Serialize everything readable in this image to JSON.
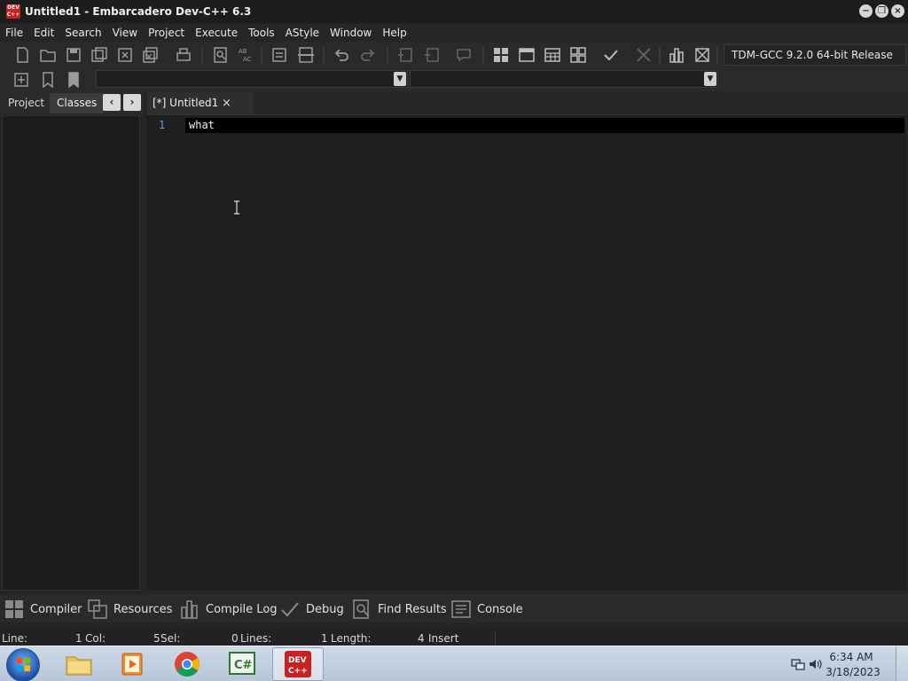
{
  "window": {
    "title": "Untitled1 - Embarcadero Dev-C++ 6.3",
    "logo_text_top": "DEV",
    "logo_text_bottom": "C++",
    "controls": {
      "minimize": "−",
      "restore": "❐",
      "close": "×"
    }
  },
  "menu": [
    "File",
    "Edit",
    "Search",
    "View",
    "Project",
    "Execute",
    "Tools",
    "AStyle",
    "Window",
    "Help"
  ],
  "toolbar": {
    "compiler_selected": "TDM-GCC 9.2.0 64-bit Release",
    "replace_icon_label_top": "AB",
    "replace_icon_label_bottom": "AC"
  },
  "left_panel": {
    "tabs": [
      "Project",
      "Classes"
    ],
    "active_tab": "Classes",
    "nav_prev": "‹",
    "nav_next": "›"
  },
  "editor": {
    "tab_label": "[*] Untitled1",
    "tab_close": "×",
    "line_number": "1",
    "code_line": "what"
  },
  "bottom_tabs": [
    "Compiler",
    "Resources",
    "Compile Log",
    "Debug",
    "Find Results",
    "Console"
  ],
  "status": {
    "line_label": "Line:",
    "line_value": "1",
    "col_label": "Col:",
    "col_value": "5",
    "sel_label": "Sel:",
    "sel_value": "0",
    "lines_label": "Lines:",
    "lines_value": "1",
    "length_label": "Length:",
    "length_value": "4",
    "mode": "Insert"
  },
  "taskbar": {
    "apps": [
      "windows-explorer",
      "media-player",
      "chrome",
      "csharp-editor",
      "dev-cpp"
    ],
    "csharp_label": "C#",
    "devcpp_label_top": "DEV",
    "devcpp_label_bottom": "C++",
    "time": "6:34 AM",
    "date": "3/18/2023"
  },
  "colors": {
    "background": "#252525",
    "editor_bg": "#1f1f1f",
    "line_number": "#5fa0d8",
    "brand_red": "#c62222"
  }
}
